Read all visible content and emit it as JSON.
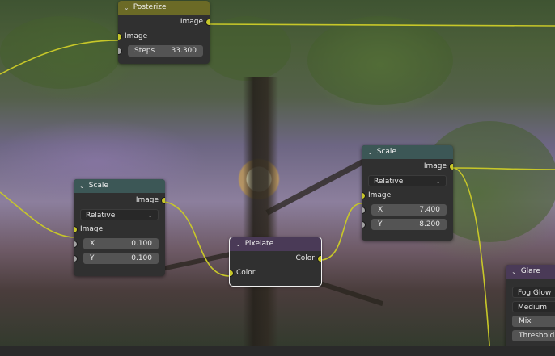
{
  "nodes": {
    "posterize": {
      "title": "Posterize",
      "output_image": "Image",
      "input_image": "Image",
      "steps_label": "Steps",
      "steps_value": "33.300"
    },
    "scale_left": {
      "title": "Scale",
      "output_image": "Image",
      "space_option": "Relative",
      "input_image": "Image",
      "x_label": "X",
      "x_value": "0.100",
      "y_label": "Y",
      "y_value": "0.100"
    },
    "pixelate": {
      "title": "Pixelate",
      "output_color": "Color",
      "input_color": "Color"
    },
    "scale_right": {
      "title": "Scale",
      "output_image": "Image",
      "space_option": "Relative",
      "input_image": "Image",
      "x_label": "X",
      "x_value": "7.400",
      "y_label": "Y",
      "y_value": "8.200"
    },
    "glare": {
      "title": "Glare",
      "type_option": "Fog Glow",
      "quality_option": "Medium",
      "mix_label": "Mix",
      "threshold_label": "Threshold"
    }
  },
  "colors": {
    "image_socket": "#c7c729",
    "value_socket": "#a1a1a1",
    "color_header": "#6b6a26",
    "distort_header": "#3c5756",
    "filter_header": "#4a3a57",
    "link": "#c7c729"
  },
  "icons": {
    "collapse": "chevron-down-icon",
    "dropdown": "chevron-down-icon"
  }
}
